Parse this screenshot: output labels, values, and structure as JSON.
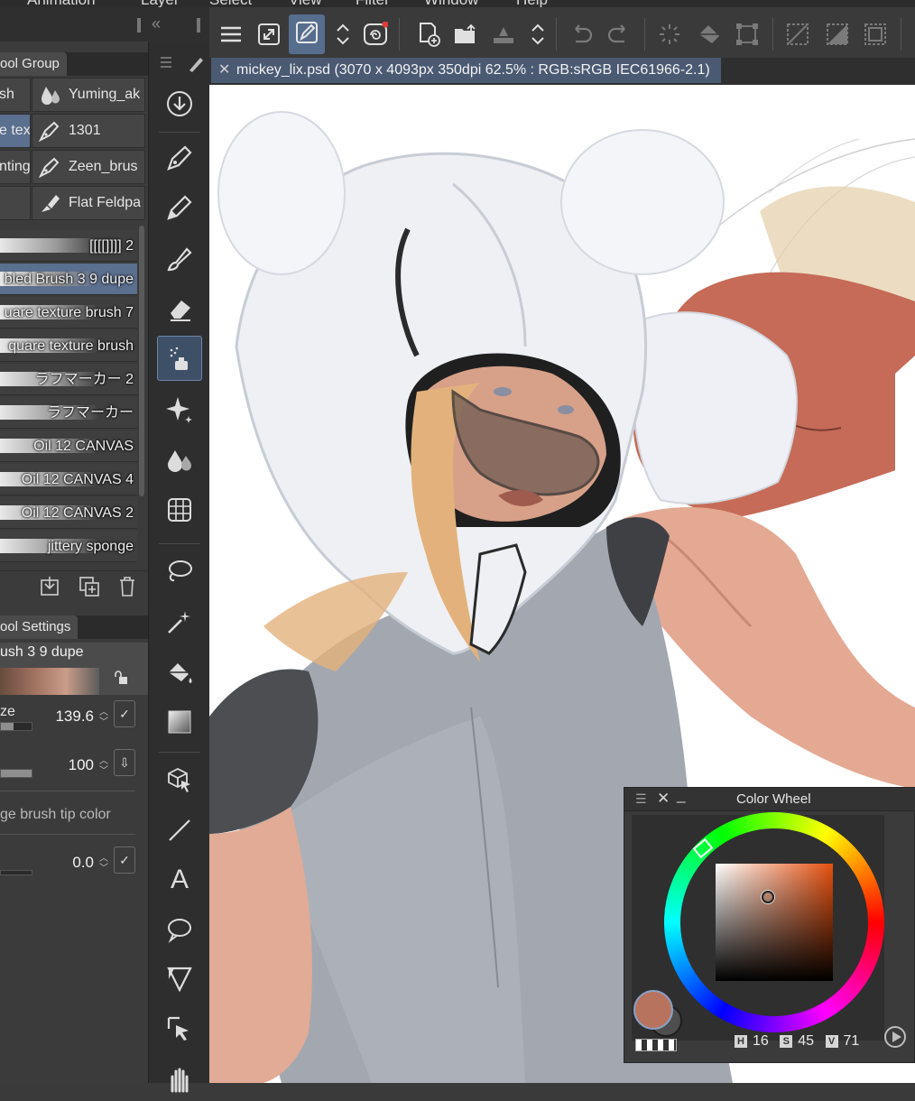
{
  "menu": [
    "Animation",
    "Layer",
    "Select",
    "View",
    "Filter",
    "Window",
    "Help"
  ],
  "left_panel": {
    "sub_tool_group_tab": "ool Group",
    "brush_grid": [
      {
        "label": "sh",
        "icon": "brush-icon",
        "selected": false
      },
      {
        "label": "Yuming_ak",
        "icon": "water-drops-icon",
        "selected": false
      },
      {
        "label": "e text",
        "icon": "brush-icon",
        "selected": true
      },
      {
        "label": "1301",
        "icon": "pen-nib-icon",
        "selected": false
      },
      {
        "label": "nting",
        "icon": "brush-icon",
        "selected": false
      },
      {
        "label": "Zeen_brus",
        "icon": "pen-nib-icon",
        "selected": false
      },
      {
        "label": "",
        "icon": "brush-icon",
        "selected": false
      },
      {
        "label": "Flat Feldpa",
        "icon": "flat-brush-icon",
        "selected": false
      }
    ],
    "brush_list": [
      {
        "label": "[[[[]]]] 2",
        "selected": false
      },
      {
        "label": "bled Brush 3 9 dupe",
        "selected": true
      },
      {
        "label": "uare texture brush 7",
        "selected": false
      },
      {
        "label": "quare texture brush",
        "selected": false
      },
      {
        "label": "ラフマーカー 2",
        "selected": false
      },
      {
        "label": "ラフマーカー",
        "selected": false
      },
      {
        "label": "Oil 12 CANVAS",
        "selected": false
      },
      {
        "label": "Oil 12 CANVAS 4",
        "selected": false
      },
      {
        "label": "Oil 12 CANVAS 2",
        "selected": false
      },
      {
        "label": "jittery sponge",
        "selected": false
      }
    ],
    "tool_settings_tab": "ool Settings",
    "current_brush": "ush 3 9 dupe",
    "settings": {
      "size_label": "ze",
      "size_value": "139.6",
      "opacity_value": "100",
      "tip_color_label": "ge brush tip color",
      "third_value": "0.0"
    }
  },
  "document": {
    "tab_label": "mickey_lix.psd (3070 x 4093px 350dpi 62.5% : RGB:sRGB IEC61966-2.1)"
  },
  "color_wheel": {
    "title": "Color Wheel",
    "h_key": "H",
    "h": "16",
    "s_key": "S",
    "s": "45",
    "v_key": "V",
    "v": "71",
    "main_color": "#b7735e"
  },
  "colors": {
    "accent": "#5b6f8e",
    "panel": "#3b3b3b"
  }
}
